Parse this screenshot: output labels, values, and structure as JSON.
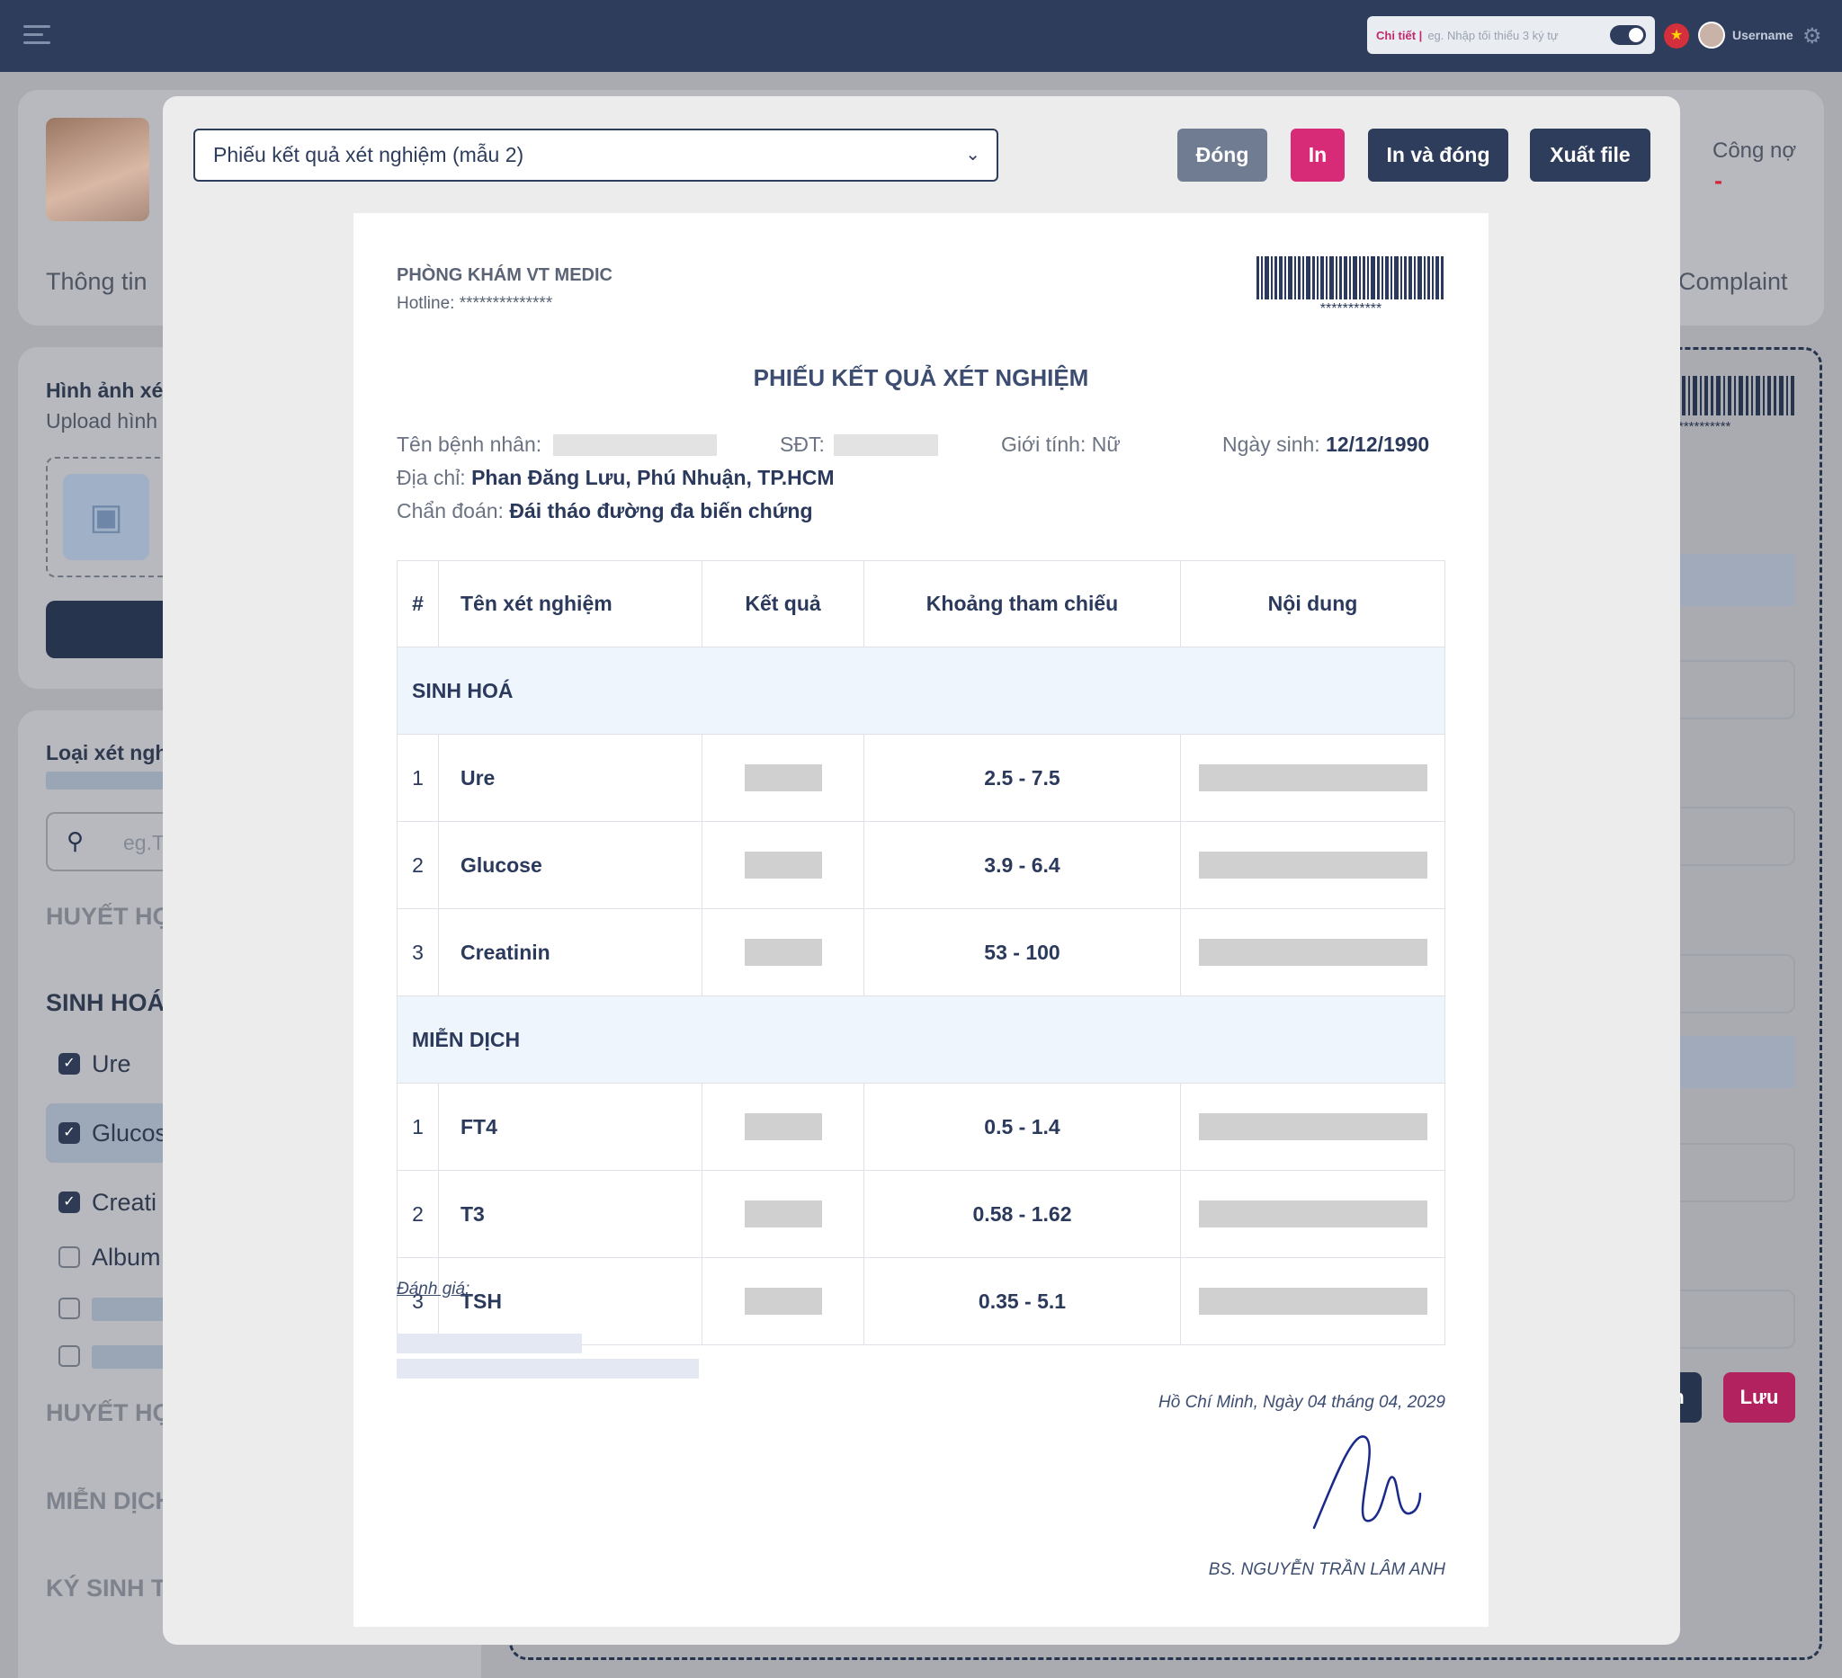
{
  "topbar": {
    "search_label": "Chi tiết |",
    "search_placeholder": "eg. Nhập tối thiểu 3 ký tự",
    "username": "Username"
  },
  "background": {
    "tab_info": "Thông tin",
    "tab_debt": "Công nợ",
    "debt_value": "-",
    "tab_complaint": "Complaint",
    "image_title": "Hình ảnh xé",
    "image_sub": "Upload hình",
    "test_type_title": "Loại xét ngh",
    "search_placeholder": "eg.T",
    "group_huyet_hoc": "HUYẾT HỌ",
    "group_sinh_hoa": "SINH HOÁ",
    "item_ure": "Ure",
    "item_glucose": "Glucos",
    "item_creatinin": "Creati",
    "item_albumin": "Album",
    "group_huyet_hoc_2": "HUYẾT HỌ",
    "group_mien_dich": "MIỄN DỊCH",
    "group_ky_sinh": "KÝ SINH T",
    "barcode_caption": "**********",
    "btn_partial": "n",
    "btn_save": "Lưu"
  },
  "modal": {
    "template_select": "Phiếu kết quả xét nghiệm (mẫu 2)",
    "btn_close": "Đóng",
    "btn_print": "In",
    "btn_print_close": "In và đóng",
    "btn_export": "Xuất file",
    "colors": {
      "close": "#6f7c92",
      "print": "#d82b77",
      "dark": "#2e3d5c"
    }
  },
  "document": {
    "clinic_name": "PHÒNG KHÁM VT MEDIC",
    "hotline": "Hotline: **************",
    "barcode_caption": "***********",
    "title": "PHIẾU KẾT QUẢ XÉT NGHIỆM",
    "patient_label": "Tên bệnh nhân:",
    "phone_label": "SĐT:",
    "gender_label": "Giới tính: Nữ",
    "dob_label": "Ngày sinh:",
    "dob_value": "12/12/1990",
    "address_label": "Địa chỉ:",
    "address_value": "Phan Đăng Lưu, Phú Nhuận, TP.HCM",
    "diagnosis_label": "Chẩn đoán:",
    "diagnosis_value": "Đái tháo đường đa biến chứng",
    "table": {
      "headers": [
        "#",
        "Tên xét nghiệm",
        "Kết quả",
        "Khoảng tham chiếu",
        "Nội dung"
      ],
      "sections": [
        {
          "name": "SINH HOÁ",
          "rows": [
            {
              "num": "1",
              "name": "Ure",
              "ref": "2.5 - 7.5"
            },
            {
              "num": "2",
              "name": "Glucose",
              "ref": "3.9 - 6.4"
            },
            {
              "num": "3",
              "name": "Creatinin",
              "ref": "53 - 100"
            }
          ]
        },
        {
          "name": "MIỄN DỊCH",
          "rows": [
            {
              "num": "1",
              "name": "FT4",
              "ref": "0.5 - 1.4"
            },
            {
              "num": "2",
              "name": "T3",
              "ref": "0.58 - 1.62"
            },
            {
              "num": "3",
              "name": "TSH",
              "ref": "0.35 - 5.1"
            }
          ]
        }
      ]
    },
    "evaluation_label": "Đánh giá:",
    "place_date": "Hồ Chí Minh, Ngày 04 tháng 04, 2029",
    "doctor": "BS. NGUYỄN TRẦN LÂM ANH"
  }
}
